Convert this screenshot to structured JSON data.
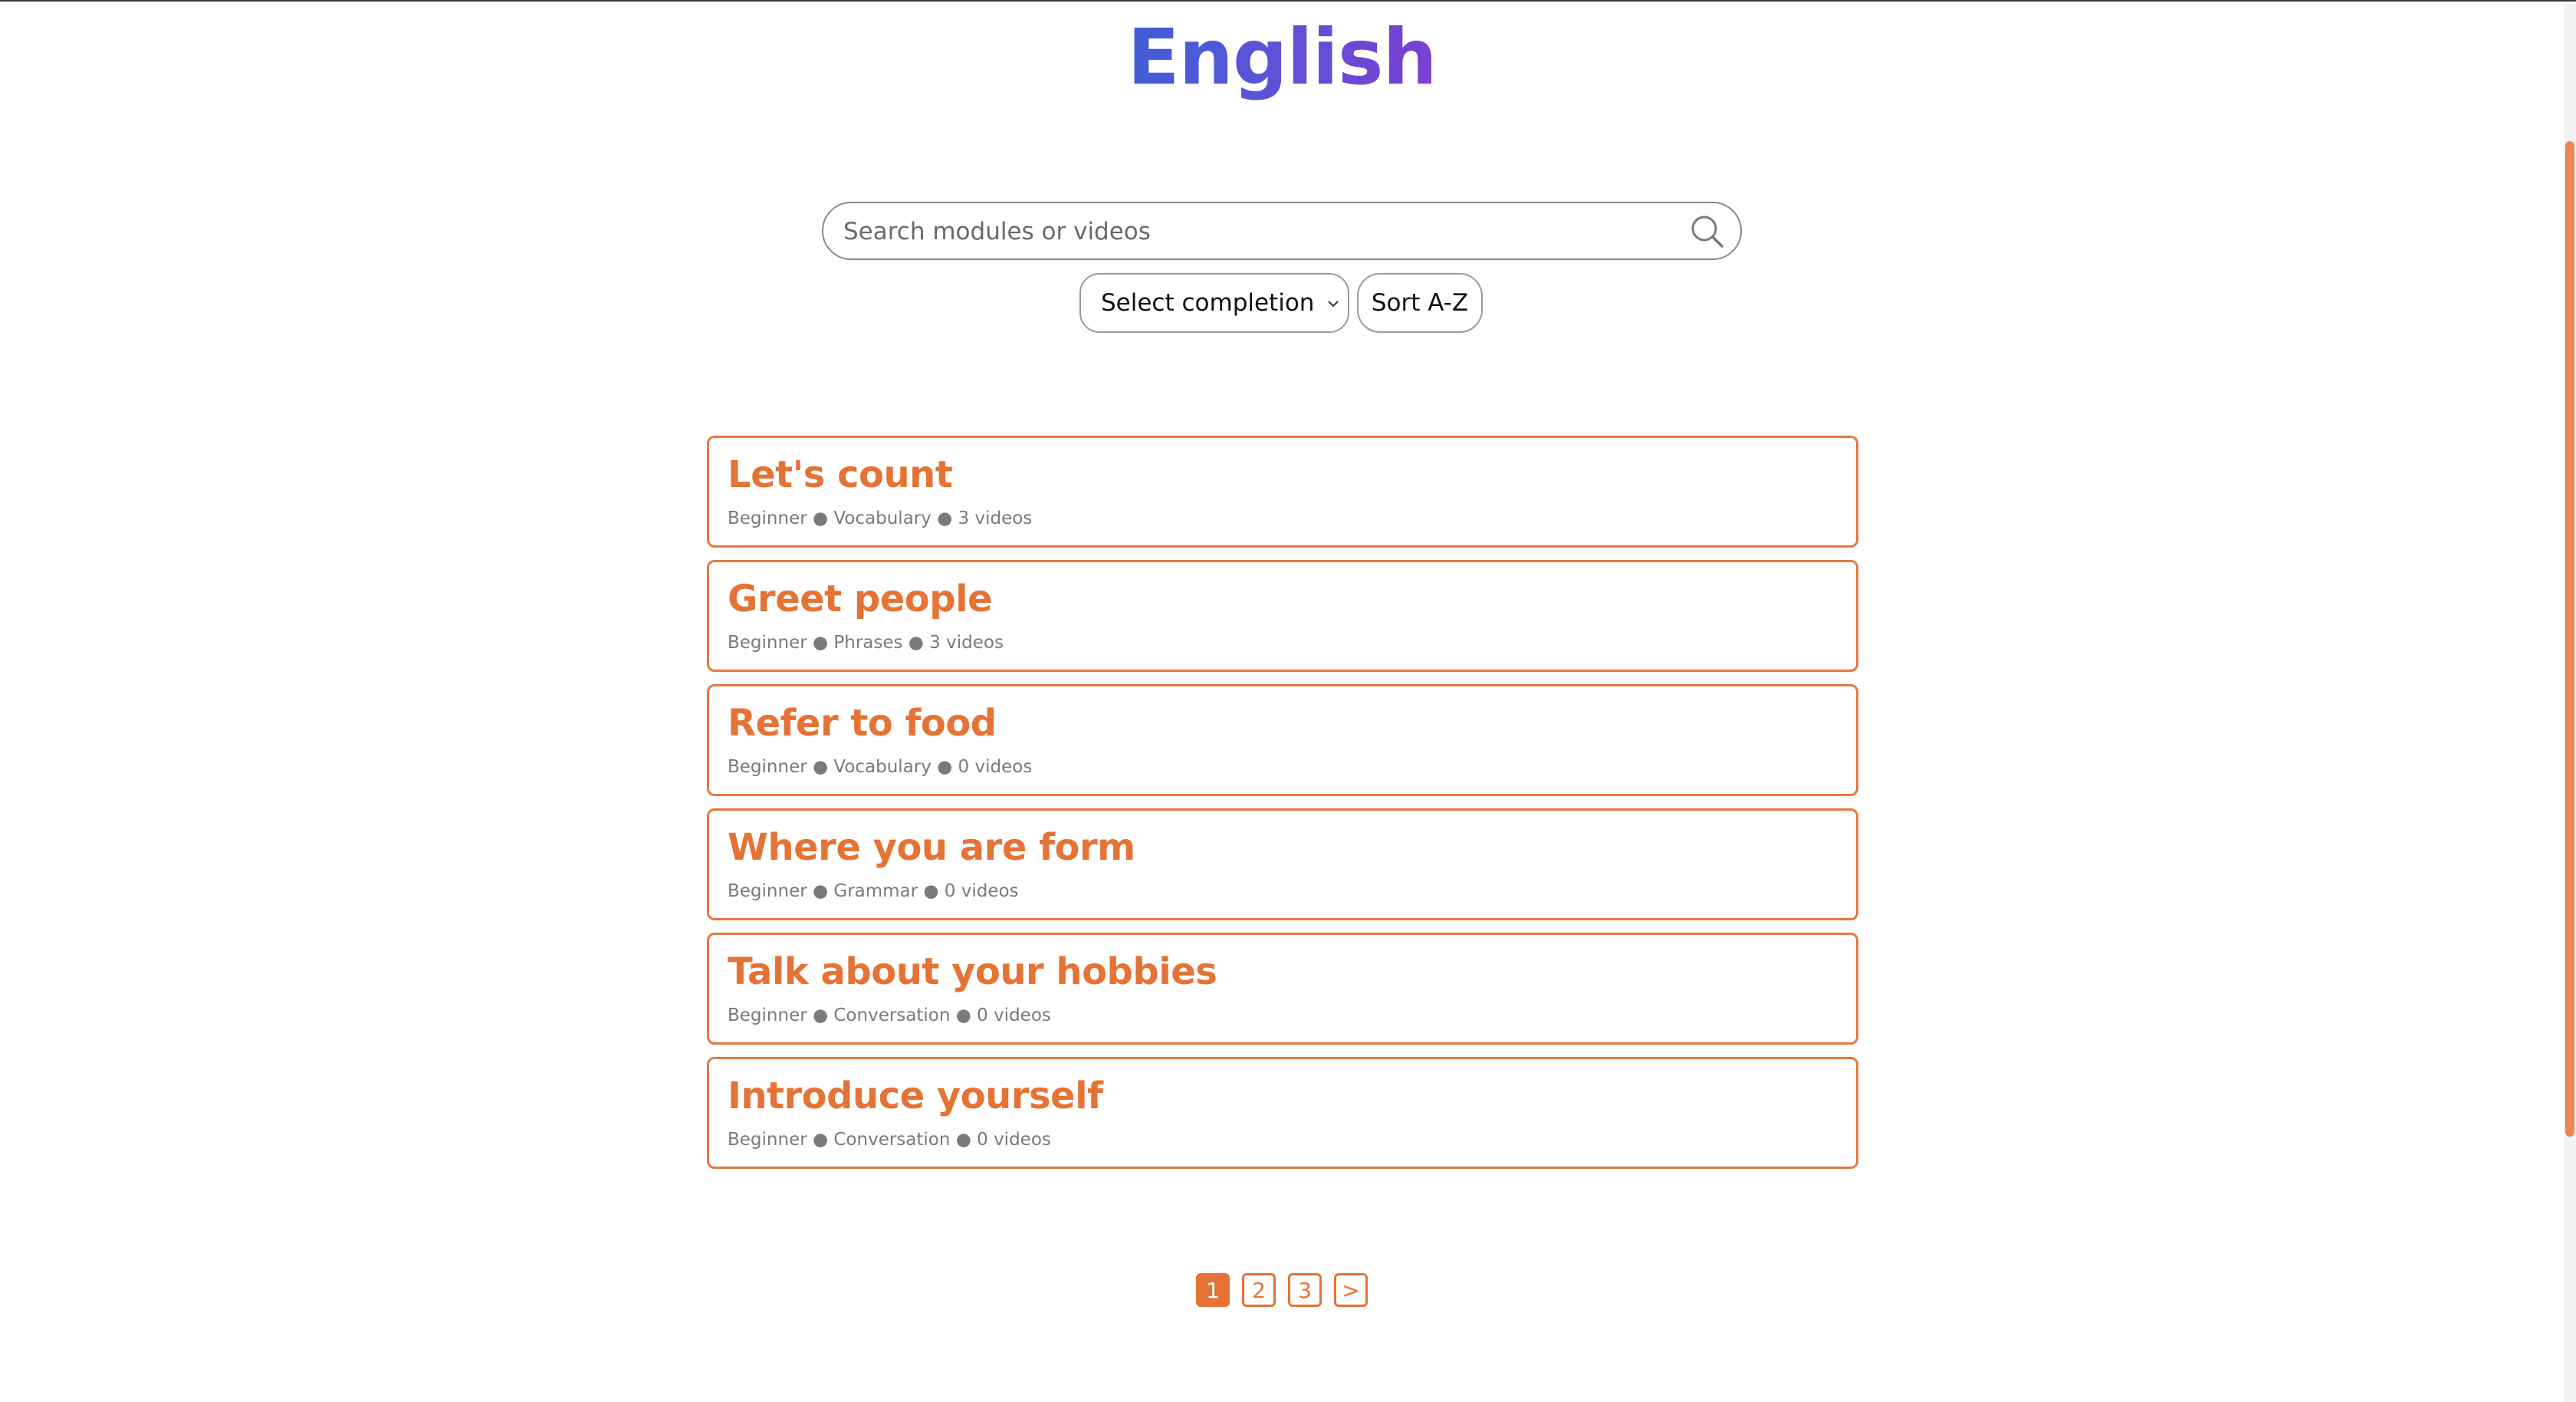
{
  "header": {
    "title": "English"
  },
  "search": {
    "placeholder": "Search modules or videos",
    "value": ""
  },
  "filters": {
    "completion_selected": "Select completion",
    "sort_label": "Sort A-Z"
  },
  "modules": [
    {
      "title": "Let's count",
      "meta": "Beginner ● Vocabulary ● 3 videos"
    },
    {
      "title": "Greet people",
      "meta": "Beginner ● Phrases ● 3 videos"
    },
    {
      "title": "Refer to food",
      "meta": "Beginner ● Vocabulary ● 0 videos"
    },
    {
      "title": "Where you are form",
      "meta": "Beginner ● Grammar ● 0 videos"
    },
    {
      "title": "Talk about your hobbies",
      "meta": "Beginner ● Conversation ● 0 videos"
    },
    {
      "title": "Introduce yourself",
      "meta": "Beginner ● Conversation ● 0 videos"
    }
  ],
  "pagination": {
    "pages": [
      "1",
      "2",
      "3"
    ],
    "current": "1",
    "next_label": ">"
  },
  "colors": {
    "accent": "#e57335",
    "title_gradient_start": "#3f5fd6",
    "title_gradient_end": "#7a3fd3"
  },
  "icons": {
    "search": "search-icon",
    "dropdown": "chevron-down-icon"
  }
}
